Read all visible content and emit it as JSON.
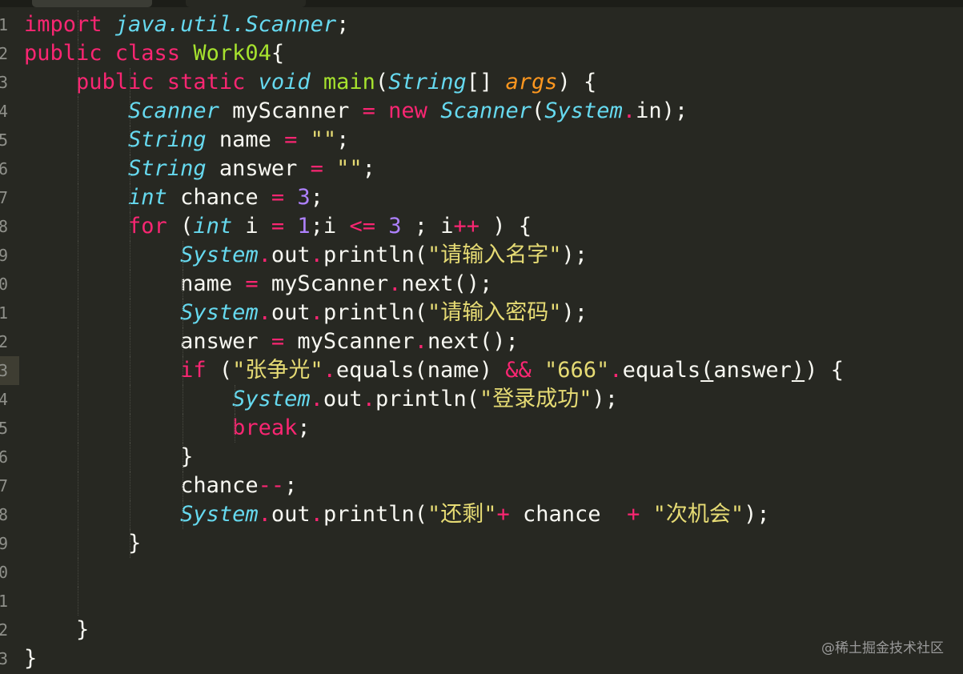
{
  "editor": {
    "line_numbers": [
      "1",
      "2",
      "3",
      "4",
      "5",
      "6",
      "7",
      "8",
      "9",
      "0",
      "1",
      "2",
      "3",
      "4",
      "5",
      "6",
      "7",
      "8",
      "9",
      "0",
      "1",
      "2",
      "3"
    ],
    "highlighted_line_index": 12,
    "lines": [
      [
        {
          "t": "import ",
          "c": "kw"
        },
        {
          "t": "java.util.Scanner",
          "c": "ty"
        },
        {
          "t": ";",
          "c": "pl"
        }
      ],
      [
        {
          "t": "public class ",
          "c": "kw"
        },
        {
          "t": "Work04",
          "c": "cls"
        },
        {
          "t": "{",
          "c": "pl"
        }
      ],
      [
        {
          "t": "    public static ",
          "c": "kw"
        },
        {
          "t": "void ",
          "c": "ty"
        },
        {
          "t": "main",
          "c": "fn"
        },
        {
          "t": "(",
          "c": "pl"
        },
        {
          "t": "String",
          "c": "ty"
        },
        {
          "t": "[] ",
          "c": "pl"
        },
        {
          "t": "args",
          "c": "par"
        },
        {
          "t": ") {",
          "c": "pl"
        }
      ],
      [
        {
          "t": "        ",
          "c": "pl"
        },
        {
          "t": "Scanner ",
          "c": "ty"
        },
        {
          "t": "myScanner ",
          "c": "pl"
        },
        {
          "t": "= ",
          "c": "op"
        },
        {
          "t": "new ",
          "c": "kw"
        },
        {
          "t": "Scanner",
          "c": "ty"
        },
        {
          "t": "(",
          "c": "pl"
        },
        {
          "t": "System",
          "c": "ty"
        },
        {
          "t": ".",
          "c": "op"
        },
        {
          "t": "in);",
          "c": "pl"
        }
      ],
      [
        {
          "t": "        ",
          "c": "pl"
        },
        {
          "t": "String ",
          "c": "ty"
        },
        {
          "t": "name ",
          "c": "pl"
        },
        {
          "t": "= ",
          "c": "op"
        },
        {
          "t": "\"\"",
          "c": "str"
        },
        {
          "t": ";",
          "c": "pl"
        }
      ],
      [
        {
          "t": "        ",
          "c": "pl"
        },
        {
          "t": "String ",
          "c": "ty"
        },
        {
          "t": "answer ",
          "c": "pl"
        },
        {
          "t": "= ",
          "c": "op"
        },
        {
          "t": "\"\"",
          "c": "str"
        },
        {
          "t": ";",
          "c": "pl"
        }
      ],
      [
        {
          "t": "        ",
          "c": "pl"
        },
        {
          "t": "int ",
          "c": "ty"
        },
        {
          "t": "chance ",
          "c": "pl"
        },
        {
          "t": "= ",
          "c": "op"
        },
        {
          "t": "3",
          "c": "num"
        },
        {
          "t": ";",
          "c": "pl"
        }
      ],
      [
        {
          "t": "        ",
          "c": "pl"
        },
        {
          "t": "for ",
          "c": "kw"
        },
        {
          "t": "(",
          "c": "pl"
        },
        {
          "t": "int ",
          "c": "ty"
        },
        {
          "t": "i ",
          "c": "pl"
        },
        {
          "t": "= ",
          "c": "op"
        },
        {
          "t": "1",
          "c": "num"
        },
        {
          "t": ";i ",
          "c": "pl"
        },
        {
          "t": "<= ",
          "c": "op"
        },
        {
          "t": "3",
          "c": "num"
        },
        {
          "t": " ; i",
          "c": "pl"
        },
        {
          "t": "++",
          "c": "op"
        },
        {
          "t": " ) {",
          "c": "pl"
        }
      ],
      [
        {
          "t": "            ",
          "c": "pl"
        },
        {
          "t": "System",
          "c": "ty"
        },
        {
          "t": ".",
          "c": "op"
        },
        {
          "t": "out",
          "c": "pl"
        },
        {
          "t": ".",
          "c": "op"
        },
        {
          "t": "println(",
          "c": "pl"
        },
        {
          "t": "\"请输入名字\"",
          "c": "str"
        },
        {
          "t": ");",
          "c": "pl"
        }
      ],
      [
        {
          "t": "            name ",
          "c": "pl"
        },
        {
          "t": "= ",
          "c": "op"
        },
        {
          "t": "myScanner",
          "c": "pl"
        },
        {
          "t": ".",
          "c": "op"
        },
        {
          "t": "next();",
          "c": "pl"
        }
      ],
      [
        {
          "t": "            ",
          "c": "pl"
        },
        {
          "t": "System",
          "c": "ty"
        },
        {
          "t": ".",
          "c": "op"
        },
        {
          "t": "out",
          "c": "pl"
        },
        {
          "t": ".",
          "c": "op"
        },
        {
          "t": "println(",
          "c": "pl"
        },
        {
          "t": "\"请输入密码\"",
          "c": "str"
        },
        {
          "t": ");",
          "c": "pl"
        }
      ],
      [
        {
          "t": "            answer ",
          "c": "pl"
        },
        {
          "t": "= ",
          "c": "op"
        },
        {
          "t": "myScanner",
          "c": "pl"
        },
        {
          "t": ".",
          "c": "op"
        },
        {
          "t": "next();",
          "c": "pl"
        }
      ],
      [
        {
          "t": "            ",
          "c": "pl"
        },
        {
          "t": "if ",
          "c": "kw"
        },
        {
          "t": "(",
          "c": "pl"
        },
        {
          "t": "\"张争光\"",
          "c": "str"
        },
        {
          "t": ".",
          "c": "op"
        },
        {
          "t": "equals(name) ",
          "c": "pl"
        },
        {
          "t": "&& ",
          "c": "op"
        },
        {
          "t": "\"666\"",
          "c": "str"
        },
        {
          "t": ".",
          "c": "op"
        },
        {
          "t": "equals",
          "c": "pl"
        },
        {
          "t": "(",
          "c": "ul"
        },
        {
          "t": "answer",
          "c": "pl"
        },
        {
          "t": ")",
          "c": "ul"
        },
        {
          "t": ") {",
          "c": "pl"
        }
      ],
      [
        {
          "t": "                ",
          "c": "pl"
        },
        {
          "t": "System",
          "c": "ty"
        },
        {
          "t": ".",
          "c": "op"
        },
        {
          "t": "out",
          "c": "pl"
        },
        {
          "t": ".",
          "c": "op"
        },
        {
          "t": "println(",
          "c": "pl"
        },
        {
          "t": "\"登录成功\"",
          "c": "str"
        },
        {
          "t": ");",
          "c": "pl"
        }
      ],
      [
        {
          "t": "                ",
          "c": "pl"
        },
        {
          "t": "break",
          "c": "kw"
        },
        {
          "t": ";",
          "c": "pl"
        }
      ],
      [
        {
          "t": "            }",
          "c": "pl"
        }
      ],
      [
        {
          "t": "            chance",
          "c": "pl"
        },
        {
          "t": "--",
          "c": "op"
        },
        {
          "t": ";",
          "c": "pl"
        }
      ],
      [
        {
          "t": "            ",
          "c": "pl"
        },
        {
          "t": "System",
          "c": "ty"
        },
        {
          "t": ".",
          "c": "op"
        },
        {
          "t": "out",
          "c": "pl"
        },
        {
          "t": ".",
          "c": "op"
        },
        {
          "t": "println(",
          "c": "pl"
        },
        {
          "t": "\"还剩\"",
          "c": "str"
        },
        {
          "t": "+ ",
          "c": "op"
        },
        {
          "t": "chance  ",
          "c": "pl"
        },
        {
          "t": "+ ",
          "c": "op"
        },
        {
          "t": "\"次机会\"",
          "c": "str"
        },
        {
          "t": ");",
          "c": "pl"
        }
      ],
      [
        {
          "t": "        }",
          "c": "pl"
        }
      ],
      [],
      [],
      [
        {
          "t": "    }",
          "c": "pl"
        }
      ],
      [
        {
          "t": "}",
          "c": "pl"
        }
      ]
    ],
    "guides": [
      [
        4
      ],
      [
        4
      ],
      [
        4,
        8
      ],
      [
        4,
        8
      ],
      [
        4,
        8
      ],
      [
        4,
        8
      ],
      [
        4,
        8
      ],
      [
        4,
        8
      ],
      [
        4,
        8,
        12
      ],
      [
        4,
        8,
        12
      ],
      [
        4,
        8,
        12
      ],
      [
        4,
        8,
        12
      ],
      [
        4,
        8,
        12
      ],
      [
        4,
        8,
        12,
        16
      ],
      [
        4,
        8,
        12,
        16
      ],
      [
        4,
        8,
        12
      ],
      [
        4,
        8,
        12
      ],
      [
        4,
        8,
        12
      ],
      [
        4,
        8
      ],
      [
        4
      ],
      [
        4
      ],
      [],
      []
    ]
  },
  "watermark": "@稀土掘金技术社区",
  "colors": {
    "background": "#272822",
    "keyword": "#f92672",
    "type": "#66d9ef",
    "class_name": "#a6e22e",
    "string": "#e6db74",
    "number": "#ae81ff",
    "parameter": "#fd971f",
    "plain": "#f8f8f2"
  }
}
